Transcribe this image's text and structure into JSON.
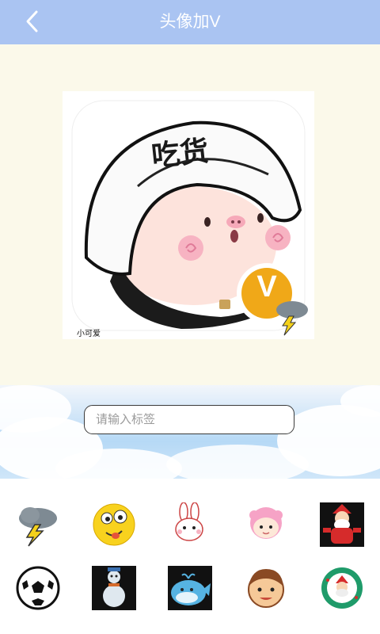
{
  "header": {
    "title": "头像加V",
    "back_icon": "chevron-left-icon"
  },
  "preview": {
    "helmet_text": "吃货",
    "badge_letter": "V",
    "caption": "小可爱",
    "avatar": "pig-wearing-helmet-illustration"
  },
  "tag_input": {
    "value": "",
    "placeholder": "请输入标签"
  },
  "stickers": [
    {
      "name": "thunderstorm-cloud-icon"
    },
    {
      "name": "silly-face-emoji-icon"
    },
    {
      "name": "bunny-icon"
    },
    {
      "name": "pink-hair-girl-icon"
    },
    {
      "name": "santa-claus-icon"
    },
    {
      "name": "soccer-ball-icon"
    },
    {
      "name": "snowman-icon"
    },
    {
      "name": "blue-whale-icon"
    },
    {
      "name": "boy-face-icon"
    },
    {
      "name": "christmas-wreath-santa-icon"
    }
  ],
  "colors": {
    "header_bg": "#aac4f2",
    "canvas_bg": "#fbf9ea",
    "badge": "#f0a818"
  }
}
